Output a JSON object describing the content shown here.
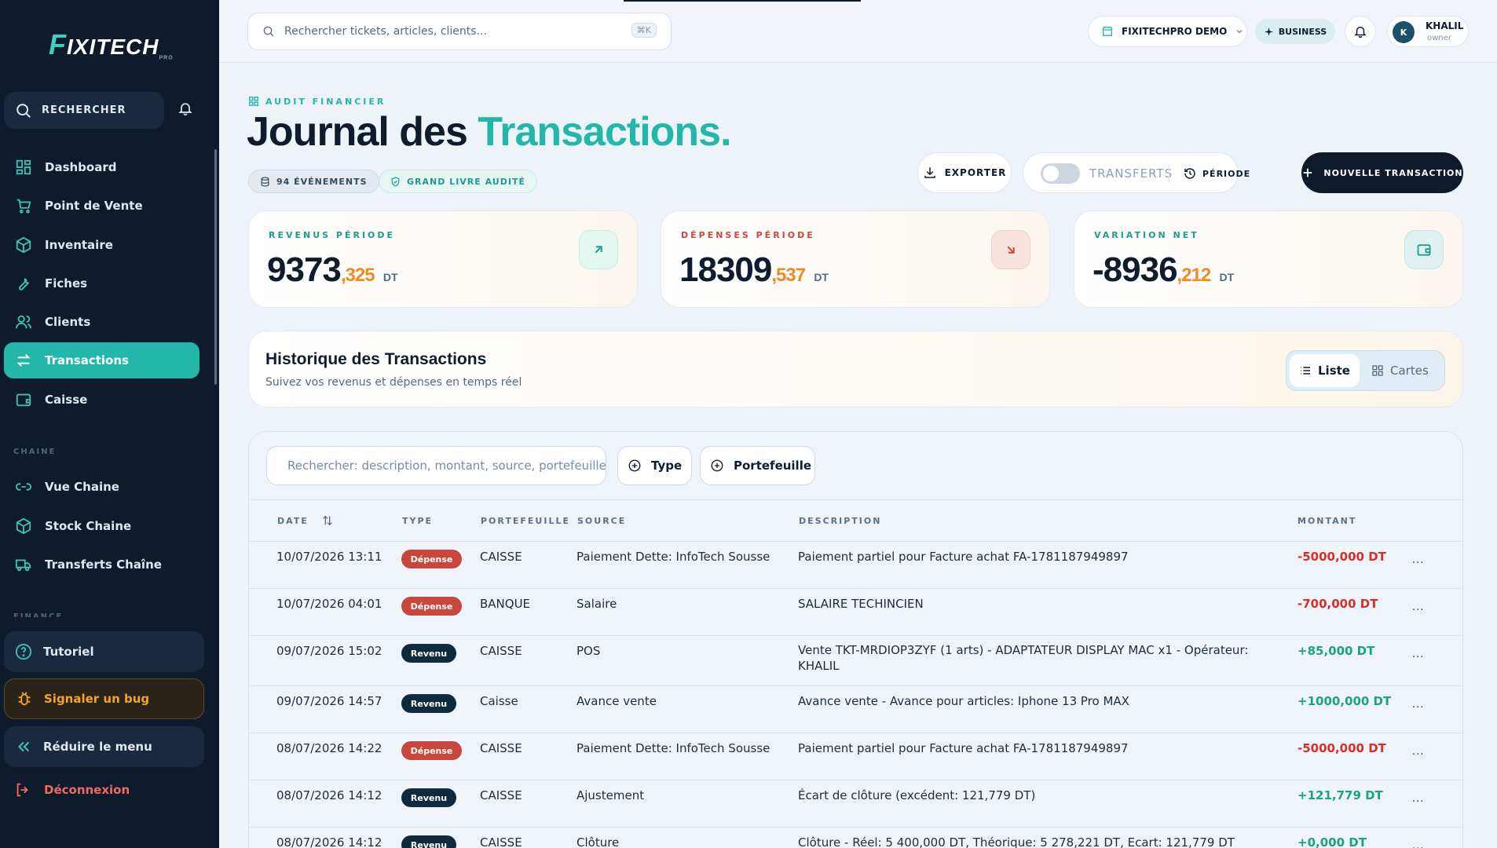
{
  "sidebar": {
    "logo": {
      "initial": "F",
      "rest": "IXITECH",
      "tag": "PRO"
    },
    "search_label": "RECHERCHER",
    "items": [
      {
        "label": "Dashboard",
        "icon": "dashboard-icon"
      },
      {
        "label": "Point de Vente",
        "icon": "cart-icon"
      },
      {
        "label": "Inventaire",
        "icon": "box-icon"
      },
      {
        "label": "Fiches",
        "icon": "wrench-icon"
      },
      {
        "label": "Clients",
        "icon": "users-icon"
      },
      {
        "label": "Transactions",
        "icon": "transfer-icon",
        "active": true
      },
      {
        "label": "Caisse",
        "icon": "wallet-icon"
      }
    ],
    "section_chaine": "CHAINE",
    "chaine_items": [
      {
        "label": "Vue Chaine",
        "icon": "link-icon"
      },
      {
        "label": "Stock Chaine",
        "icon": "box-icon"
      },
      {
        "label": "Transferts Chaîne",
        "icon": "truck-icon"
      }
    ],
    "section_finance": "FINANCE",
    "tutorial": "Tutoriel",
    "bug": "Signaler un bug",
    "collapse": "Réduire le menu",
    "logout": "Déconnexion"
  },
  "topbar": {
    "search_placeholder": "Rechercher tickets, articles, clients...",
    "shortcut": "⌘K",
    "store": "FIXITECHPRO DEMO",
    "plan": "BUSINESS",
    "user_initial": "K",
    "user_name": "KHALIL",
    "user_role": "owner"
  },
  "header": {
    "eyebrow": "AUDIT FINANCIER",
    "title_a": "Journal des ",
    "title_b": "Transactions.",
    "events": "94 ÉVÉNEMENTS",
    "ledger": "GRAND LIVRE AUDITÉ",
    "export": "EXPORTER",
    "transfers": "TRANSFERTS",
    "period": "PÉRIODE",
    "new": "NOUVELLE TRANSACTION"
  },
  "kpis": [
    {
      "label": "REVENUS PÉRIODE",
      "int": "9373",
      "dec": ",325",
      "cur": "DT",
      "color": "#1a9d8f"
    },
    {
      "label": "DÉPENSES PÉRIODE",
      "int": "18309",
      "dec": ",537",
      "cur": "DT",
      "color": "#d0463c"
    },
    {
      "label": "VARIATION NET",
      "int": "-8936",
      "dec": ",212",
      "cur": "DT",
      "color": "#1a9d8f"
    }
  ],
  "history": {
    "title": "Historique des Transactions",
    "subtitle": "Suivez vos revenus et dépenses en temps réel",
    "view_list": "Liste",
    "view_cards": "Cartes"
  },
  "table": {
    "search_placeholder": "Rechercher: description, montant, source, portefeuille",
    "filter_type": "Type",
    "filter_wallet": "Portefeuille",
    "headers": {
      "date": "DATE",
      "type": "TYPE",
      "wallet": "PORTEFEUILLE",
      "source": "SOURCE",
      "desc": "DESCRIPTION",
      "amount": "MONTANT"
    },
    "rows": [
      {
        "date": "10/07/2026 13:11",
        "type": "Dépense",
        "kind": "dep",
        "wallet": "CAISSE",
        "source": "Paiement Dette: InfoTech Sousse",
        "desc": "Paiement partiel pour Facture achat FA-1781187949897",
        "amount": "-5000,000 DT",
        "more": "..."
      },
      {
        "date": "10/07/2026 04:01",
        "type": "Dépense",
        "kind": "dep",
        "wallet": "BANQUE",
        "source": "Salaire",
        "desc": "SALAIRE TECHINCIEN",
        "amount": "-700,000 DT",
        "more": "..."
      },
      {
        "date": "09/07/2026 15:02",
        "type": "Revenu",
        "kind": "rev",
        "wallet": "CAISSE",
        "source": "POS",
        "desc": "Vente TKT-MRDIOP3ZYF (1 arts) - ADAPTATEUR DISPLAY MAC x1 - Opérateur: KHALIL",
        "amount": "+85,000 DT",
        "more": "..."
      },
      {
        "date": "09/07/2026 14:57",
        "type": "Revenu",
        "kind": "rev",
        "wallet": "Caisse",
        "source": "Avance vente",
        "desc": "Avance vente - Avance pour articles: Iphone 13 Pro MAX",
        "amount": "+1000,000 DT",
        "more": "..."
      },
      {
        "date": "08/07/2026 14:22",
        "type": "Dépense",
        "kind": "dep",
        "wallet": "CAISSE",
        "source": "Paiement Dette: InfoTech Sousse",
        "desc": "Paiement partiel pour Facture achat FA-1781187949897",
        "amount": "-5000,000 DT",
        "more": "..."
      },
      {
        "date": "08/07/2026 14:12",
        "type": "Revenu",
        "kind": "rev",
        "wallet": "CAISSE",
        "source": "Ajustement",
        "desc": "Écart de clôture (excédent: 121,779 DT)",
        "amount": "+121,779 DT",
        "more": "..."
      },
      {
        "date": "08/07/2026 14:12",
        "type": "Revenu",
        "kind": "rev",
        "wallet": "CAISSE",
        "source": "Clôture",
        "desc": "Clôture - Réel: 5 400,000 DT, Théorique: 5 278,221 DT, Ecart: 121,779 DT",
        "amount": "+0,000 DT",
        "more": "..."
      }
    ]
  }
}
